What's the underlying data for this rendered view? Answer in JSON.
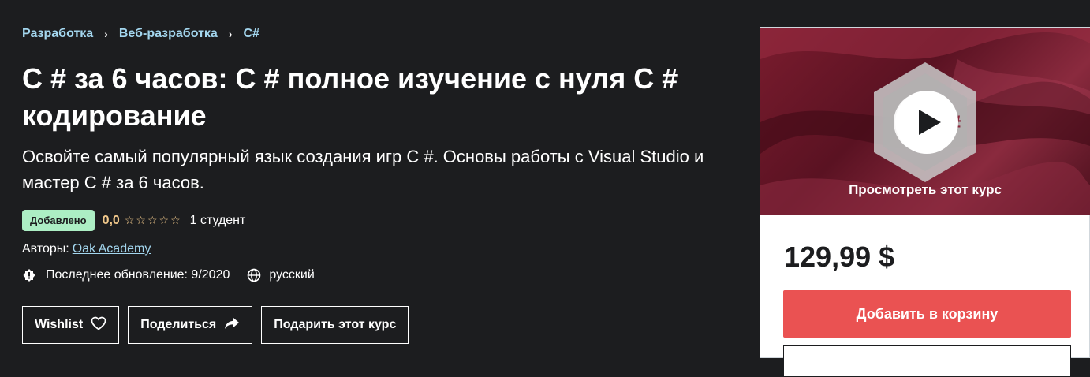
{
  "breadcrumb": {
    "items": [
      "Разработка",
      "Веб-разработка",
      "C#"
    ],
    "separator": "›"
  },
  "course": {
    "title": "C # за 6 часов: C # полное изучение с нуля C # кодирование",
    "subtitle": "Освойте самый популярный язык создания игр C #. Основы работы с Visual Studio и мастер C # за 6 часов.",
    "badge": "Добавлено",
    "rating": "0,0",
    "stars_filled": 0,
    "stars_total": 5,
    "students": "1 студент",
    "authors_label": "Авторы:",
    "author": "Oak Academy",
    "last_update": "Последнее обновление: 9/2020",
    "language": "русский"
  },
  "actions": {
    "wishlist": "Wishlist",
    "share": "Поделиться",
    "gift": "Подарить этот курс"
  },
  "sidebar": {
    "preview_label": "Просмотреть этот курс",
    "price": "129,99 $",
    "add_to_cart": "Добавить в корзину"
  },
  "colors": {
    "background": "#1c1d1f",
    "link": "#a3d6ee",
    "badge_bg": "#aceec4",
    "rating": "#f3ca8c",
    "cart_button": "#ea5252"
  },
  "icons": {
    "breadcrumb_separator": "chevron-right-icon",
    "update": "alert-badge-icon",
    "language": "globe-icon",
    "wishlist": "heart-icon",
    "share": "share-arrow-icon",
    "play": "play-icon",
    "csharp_logo": "csharp-logo-icon"
  }
}
